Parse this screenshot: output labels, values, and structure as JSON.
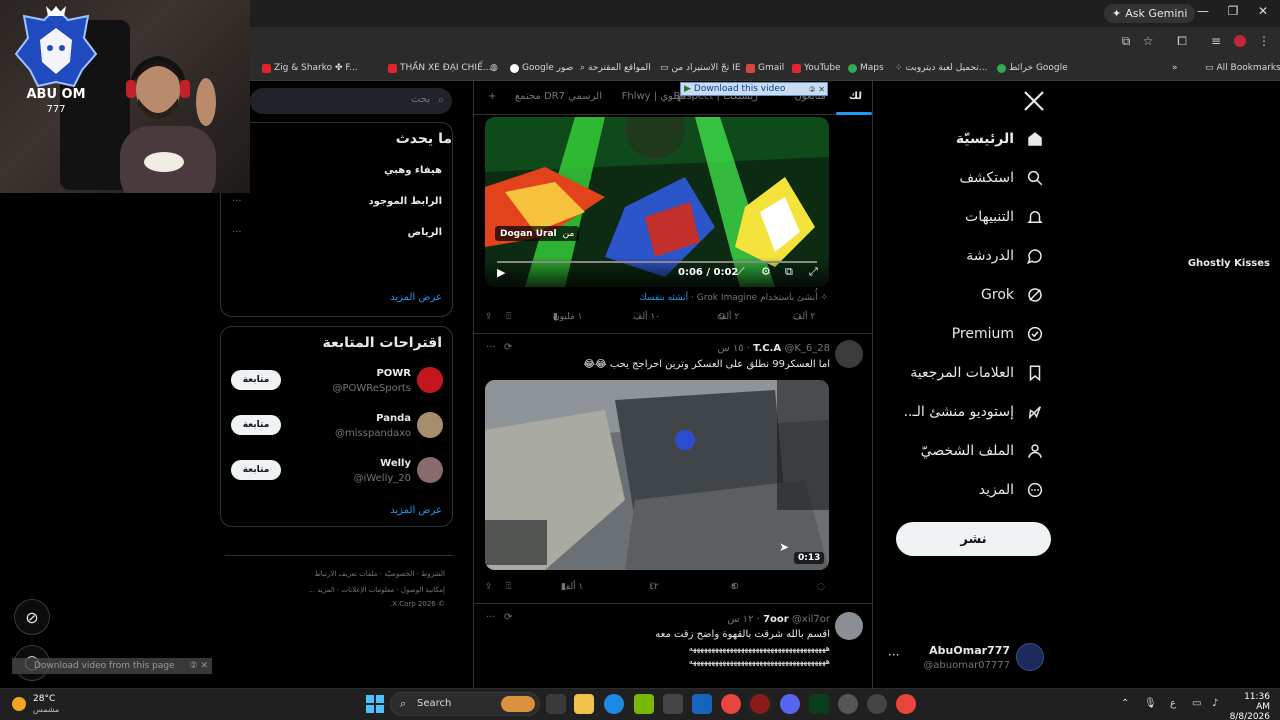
{
  "browser": {
    "ask_gemini": "Ask Gemini",
    "bookmarks": [
      "Zig & Sharko ✤ F...",
      "THẦN XE ĐẠI CHIẾ...",
      "Google صور",
      "المواقع المقترحة",
      "تجّ الاستيراد من IE",
      "Gmail",
      "YouTube",
      "Maps",
      "تحميل لعبة ديتروبت...",
      "خرائط Google"
    ],
    "all_bookmarks": "All Bookmarks"
  },
  "nav": {
    "items": [
      {
        "label": "الرئيسيّة",
        "icon": "home-icon"
      },
      {
        "label": "استكشف",
        "icon": "search-icon"
      },
      {
        "label": "التنبيهات",
        "icon": "bell-icon"
      },
      {
        "label": "الدردشة",
        "icon": "chat-icon"
      },
      {
        "label": "Grok",
        "icon": "grok-icon"
      },
      {
        "label": "Premium",
        "icon": "verified-icon"
      },
      {
        "label": "العلامات المرجعية",
        "icon": "bookmark-icon"
      },
      {
        "label": "إستوديو منشئ الـ..",
        "icon": "rocket-icon"
      },
      {
        "label": "الملف الشخصيّ",
        "icon": "profile-icon"
      },
      {
        "label": "المزيد",
        "icon": "more-circle-icon"
      }
    ],
    "post_label": "نشر",
    "account_name": "AbuOmar777",
    "account_handle": "@abuomar07777"
  },
  "tabs": [
    "لك",
    "متابَعون",
    "Respect | ريسبكت",
    "Fhlwy | فهلوي",
    "مجتمع DR7 الرسمي"
  ],
  "download_banner": "Download this video",
  "post1": {
    "attribution_prefix": "من",
    "attribution_name": "Dogan Ural",
    "video_time": "0:06 / 0:02",
    "grok_note": "أُنشئ باستخدام Grok Imagine",
    "grok_link": "أنشئه بنفسك",
    "replies": "٢ ألف",
    "reposts": "٢ ألف",
    "likes": "١٠ ألف",
    "views": "١ مليون"
  },
  "post2": {
    "name": "T.C.A",
    "handle": "@K_6_28",
    "time": "١٥ س",
    "text": "اما العسكر99 نطلق على العسكر وترين احراجج يحب 😂😂",
    "duration": "0:13",
    "replies": "",
    "reposts": "٥",
    "likes": "٤٢",
    "views": "١ ألف"
  },
  "post3": {
    "name": "7oor",
    "handle": "@xil7or",
    "time": "١٢ س",
    "text_lines": [
      "اقسم بالله شرقت بالقهوة واضح زقت معه",
      "هههههههههههههههههههههههههههههههههههههه",
      "هههههههههههههههههههههههههههههههههههههه"
    ]
  },
  "sidebar": {
    "search_placeholder": "بحث",
    "trends_title": "ما يحدث",
    "trends": [
      "هيفاء وهبي",
      "الرابط الموجود",
      "الرياض",
      "Ghostly Kisses"
    ],
    "show_more": "عرض المزيد",
    "follow_title": "اقتراحات المتابعة",
    "suggestions": [
      {
        "name": "POWR",
        "handle": "@POWReSports",
        "color": "#c4161c"
      },
      {
        "name": "Panda",
        "handle": "@misspandaxo",
        "color": "#a88d6a"
      },
      {
        "name": "Welly",
        "handle": "@iWelly_20",
        "color": "#8a6a6a"
      }
    ],
    "follow_label": "متابعة",
    "footer_line1": [
      "الشروط",
      "الخصوصيّة",
      "ملفات تعريف الارتباط"
    ],
    "footer_line2": [
      "إمكانية الوصول",
      "معلومات الإعلانات",
      "المزيد ..."
    ],
    "footer_line3": "© 2026 X Corp."
  },
  "download_page": "Download video from this page",
  "webcam": {
    "logo_text": "ABU OM",
    "logo_number": "777"
  },
  "taskbar": {
    "temp": "28°C",
    "condition": "مشمس",
    "search": "Search",
    "time": "11:36 AM",
    "date": "8/8/2026",
    "lang": "ع"
  }
}
